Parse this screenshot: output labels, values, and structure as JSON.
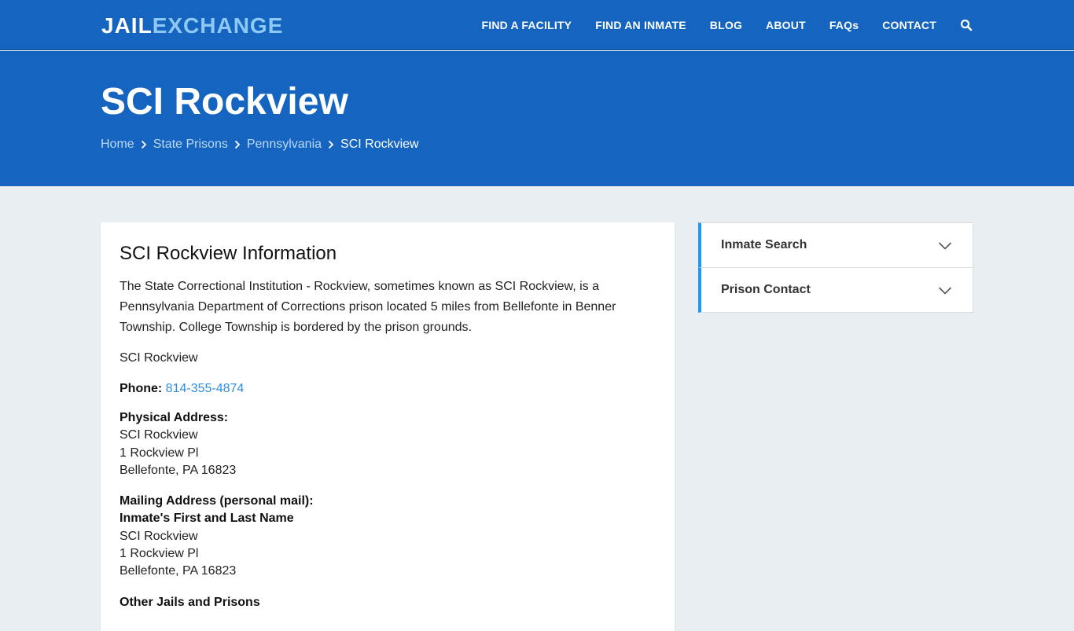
{
  "header": {
    "logo_part1": "JAIL",
    "logo_part2": "EXCHANGE",
    "nav": [
      "FIND A FACILITY",
      "FIND AN INMATE",
      "BLOG",
      "ABOUT",
      "FAQs",
      "CONTACT"
    ]
  },
  "hero": {
    "title": "SCI Rockview",
    "breadcrumbs": [
      "Home",
      "State Prisons",
      "Pennsylvania",
      "SCI Rockview"
    ]
  },
  "content": {
    "heading": "SCI Rockview Information",
    "intro": "The State Correctional Institution - Rockview, sometimes known as SCI Rockview, is a Pennsylvania Department of Corrections prison located 5 miles from Bellefonte in Benner Township. College Township is bordered by the prison grounds.",
    "facility_name": "SCI Rockview",
    "phone_label": "Phone:",
    "phone": "814-355-4874",
    "physical_label": "Physical Address:",
    "physical": [
      "SCI Rockview",
      "1 Rockview Pl",
      "Bellefonte, PA 16823"
    ],
    "mailing_label": "Mailing Address (personal mail):",
    "mailing_name": "Inmate's First and Last Name",
    "mailing": [
      "SCI Rockview",
      "1 Rockview Pl",
      "Bellefonte, PA 16823"
    ],
    "other_label": "Other Jails and Prisons"
  },
  "sidebar": {
    "items": [
      "Inmate Search",
      "Prison Contact"
    ]
  },
  "colors": {
    "brand_blue": "#1565c0",
    "accent_blue": "#2196f3",
    "link_blue": "#2f8de0"
  }
}
